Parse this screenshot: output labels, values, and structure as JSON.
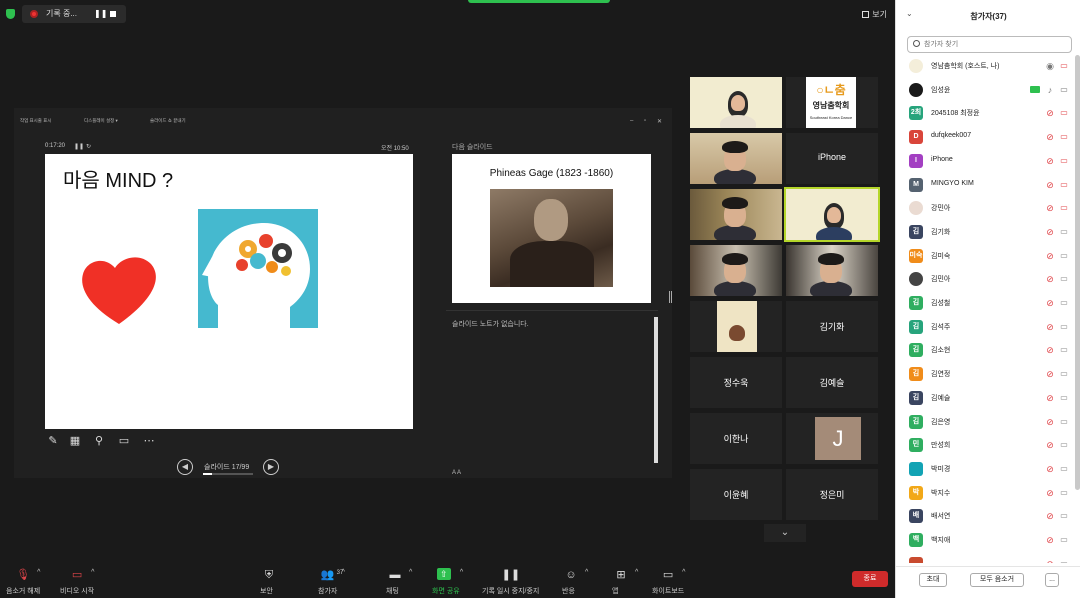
{
  "topbar": {
    "recording_label": "기록 중...",
    "pause_icon": "pause-icon",
    "view_label": "보기"
  },
  "share": {
    "toolbar": [
      "작업 표시줄 표시",
      "디스플레이 설정 ▾",
      "슬라이드 쇼 끝내기"
    ],
    "elapsed": "0:17:20",
    "clock": "오전 10:50",
    "slide_title": "마음 MIND ?",
    "next_label": "다음 슬라이드",
    "next_title": "Phineas Gage (1823 -1860)",
    "notes": "슬라이드 노트가 없습니다.",
    "pager_label": "슬라이드 17/99",
    "pager_progress": 0.17,
    "font_controls": "A  A"
  },
  "gallery": {
    "tiles": [
      {
        "name": "",
        "type": "logo"
      },
      {
        "name": "",
        "type": "logo2"
      },
      {
        "name": "",
        "type": "video"
      },
      {
        "name": "iPhone",
        "type": "name"
      },
      {
        "name": "",
        "type": "video"
      },
      {
        "name": "",
        "type": "logo-active"
      },
      {
        "name": "",
        "type": "video"
      },
      {
        "name": "",
        "type": "video"
      },
      {
        "name": "",
        "type": "photo"
      },
      {
        "name": "김기화",
        "type": "name"
      },
      {
        "name": "정수욱",
        "type": "name"
      },
      {
        "name": "김예슬",
        "type": "name"
      },
      {
        "name": "이한나",
        "type": "name"
      },
      {
        "name": "J",
        "type": "avatar"
      },
      {
        "name": "이윤혜",
        "type": "name"
      },
      {
        "name": "정은미",
        "type": "name"
      }
    ],
    "logo2_text": "영남춤학회",
    "logo2_sub": "Southeast Korea Dance",
    "logo2_brand": "○ㄴ춤"
  },
  "panel": {
    "title": "참가자(37)",
    "search_placeholder": "참가자 찾기",
    "participants": [
      {
        "name": "영남춤학회 (호스트, 나)",
        "avatar": "",
        "color": "#f4eeda",
        "photo": true
      },
      {
        "name": "임성윤",
        "avatar": "",
        "color": "#1a1a1a",
        "photo": true
      },
      {
        "name": "2045108 최정윤",
        "avatar": "2최",
        "color": "#27a47c"
      },
      {
        "name": "dufqkeek007",
        "avatar": "D",
        "color": "#d9453a"
      },
      {
        "name": "iPhone",
        "avatar": "I",
        "color": "#a33fc2"
      },
      {
        "name": "MINGYO KIM",
        "avatar": "M",
        "color": "#556270"
      },
      {
        "name": "강민아",
        "avatar": "",
        "color": "#eadbd2",
        "photo": true
      },
      {
        "name": "김기화",
        "avatar": "김",
        "color": "#3a4560"
      },
      {
        "name": "김미숙",
        "avatar": "미숙",
        "color": "#f08c1a"
      },
      {
        "name": "김민아",
        "avatar": "",
        "color": "#444",
        "photo": true
      },
      {
        "name": "김성철",
        "avatar": "김",
        "color": "#2fae60"
      },
      {
        "name": "김석주",
        "avatar": "김",
        "color": "#27a47c"
      },
      {
        "name": "김소현",
        "avatar": "김",
        "color": "#2fae60"
      },
      {
        "name": "김연정",
        "avatar": "김",
        "color": "#f08c1a"
      },
      {
        "name": "김예슬",
        "avatar": "김",
        "color": "#3a4560"
      },
      {
        "name": "김은영",
        "avatar": "김",
        "color": "#2fae60"
      },
      {
        "name": "만성희",
        "avatar": "민",
        "color": "#2fae60"
      },
      {
        "name": "박미경",
        "avatar": "",
        "color": "#12a3b4"
      },
      {
        "name": "박지수",
        "avatar": "박",
        "color": "#f2a818"
      },
      {
        "name": "배서연",
        "avatar": "배",
        "color": "#3a4560"
      },
      {
        "name": "백지애",
        "avatar": "백",
        "color": "#2fae60"
      },
      {
        "name": "",
        "avatar": "",
        "color": "#c94b2f"
      }
    ],
    "invite_label": "초대",
    "mute_all_label": "모두 음소거",
    "more_label": "..."
  },
  "bottombar": {
    "items": [
      {
        "label": "음소거 해제",
        "icon": "mic-muted-icon"
      },
      {
        "label": "비디오 시작",
        "icon": "video-off-icon"
      },
      {
        "label": "보안",
        "icon": "shield-icon"
      },
      {
        "label": "참가자",
        "icon": "participants-icon",
        "count": "37"
      },
      {
        "label": "채팅",
        "icon": "chat-icon"
      },
      {
        "label": "화면 공유",
        "icon": "share-screen-icon"
      },
      {
        "label": "기록 일시 중지/중지",
        "icon": "record-pause-icon"
      },
      {
        "label": "반응",
        "icon": "reaction-icon"
      },
      {
        "label": "앱",
        "icon": "apps-icon"
      },
      {
        "label": "화이트보드",
        "icon": "whiteboard-icon"
      }
    ],
    "end_label": "종료"
  },
  "colors": {
    "accent_green": "#2ec04f",
    "end_red": "#cf2b2b",
    "muted_red": "#e0454a",
    "active_speaker": "#b5d62a",
    "brain_bg": "#45b9cf"
  }
}
